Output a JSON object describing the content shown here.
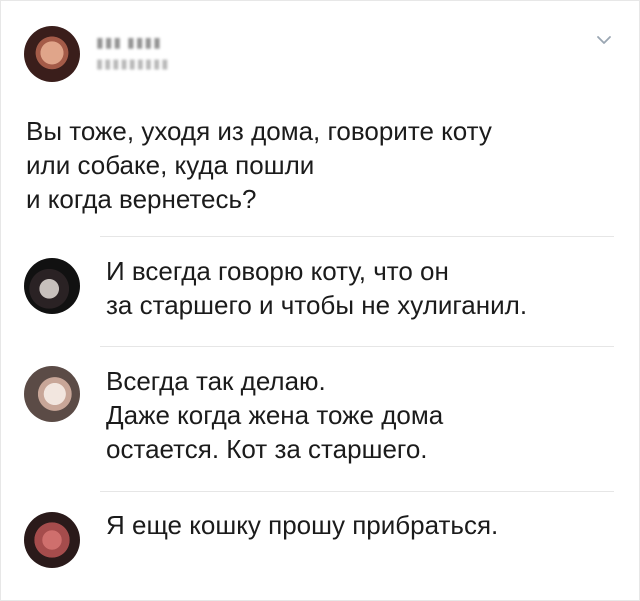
{
  "tweet": {
    "author_avatar_icon": "avatar-icon",
    "more_icon": "chevron-down-icon",
    "text": "Вы тоже, уходя из дома, говорите коту\nили собаке, куда пошли\nи когда вернетесь?"
  },
  "replies": [
    {
      "text": "И всегда говорю коту, что он\nза старшего и чтобы не хулиганил."
    },
    {
      "text": "Всегда так делаю.\nДаже когда жена тоже дома\nостается. Кот за старшего."
    },
    {
      "text": "Я еще кошку прошу прибраться."
    }
  ]
}
